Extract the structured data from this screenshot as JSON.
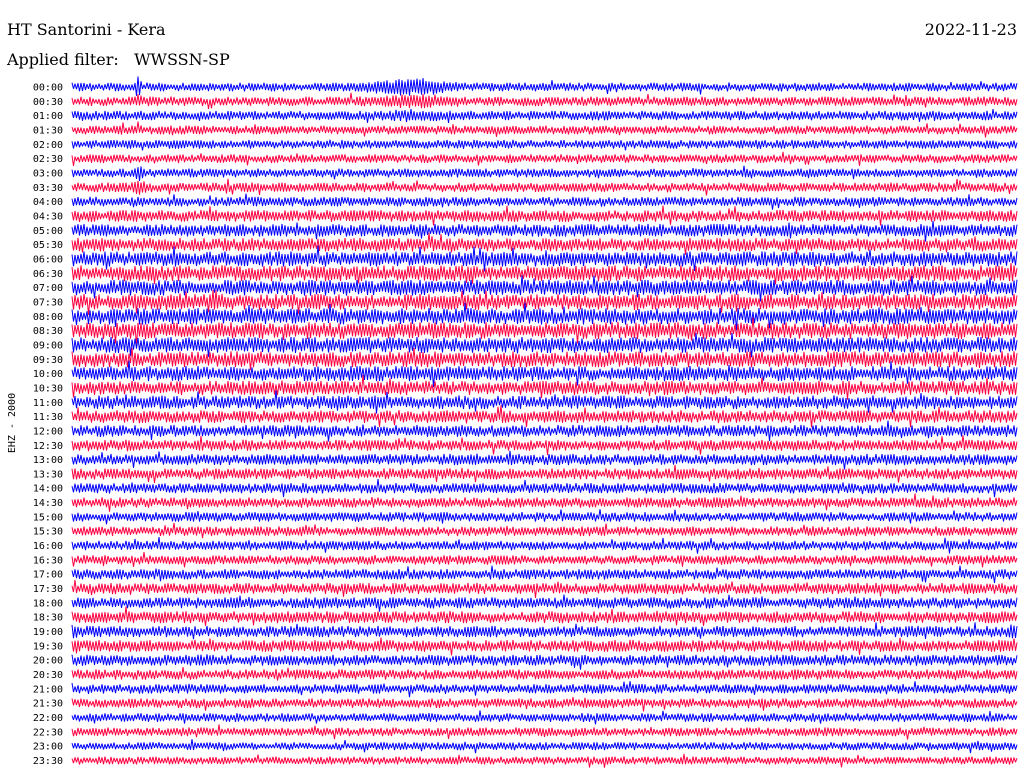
{
  "header": {
    "station": "HT Santorini - Kera",
    "date": "2022-11-23",
    "filter_label": "Applied filter:",
    "filter_value": "WWSSN-SP"
  },
  "chart_data": {
    "type": "line",
    "title": "HT Santorini - Kera",
    "subtitle": "Applied filter: WWSSN-SP",
    "ylabel": "EHZ - 2000",
    "date": "2022-11-23",
    "row_labels": [
      "00:00",
      "00:30",
      "01:00",
      "01:30",
      "02:00",
      "02:30",
      "03:00",
      "03:30",
      "04:00",
      "04:30",
      "05:00",
      "05:30",
      "06:00",
      "06:30",
      "07:00",
      "07:30",
      "08:00",
      "08:30",
      "09:00",
      "09:30",
      "10:00",
      "10:30",
      "11:00",
      "11:30",
      "12:00",
      "12:30",
      "13:00",
      "13:30",
      "14:00",
      "14:30",
      "15:00",
      "15:30",
      "16:00",
      "16:30",
      "17:00",
      "17:30",
      "18:00",
      "18:30",
      "19:00",
      "19:30",
      "20:00",
      "20:30",
      "21:00",
      "21:30",
      "22:00",
      "22:30",
      "23:00",
      "23:30"
    ],
    "trace_colors": [
      "#0000ff",
      "#ff0040"
    ],
    "grid": false,
    "relative_amplitude": [
      0.55,
      0.6,
      0.6,
      0.55,
      0.55,
      0.55,
      0.55,
      0.6,
      0.6,
      0.75,
      0.8,
      0.85,
      0.95,
      1.0,
      1.0,
      1.0,
      1.05,
      1.05,
      1.0,
      1.0,
      0.95,
      0.9,
      0.85,
      0.8,
      0.75,
      0.7,
      0.7,
      0.7,
      0.65,
      0.65,
      0.6,
      0.6,
      0.6,
      0.6,
      0.65,
      0.7,
      0.7,
      0.75,
      0.7,
      0.75,
      0.7,
      0.65,
      0.6,
      0.6,
      0.55,
      0.55,
      0.5,
      0.5
    ],
    "events": [
      {
        "row": 0,
        "position": 0.07,
        "amplitude": 5.5,
        "width": 0.004
      },
      {
        "row": 1,
        "position": 0.07,
        "amplitude": 2.5,
        "width": 0.004
      },
      {
        "row": 0,
        "position": 0.355,
        "amplitude": 3.2,
        "width": 0.06
      },
      {
        "row": 1,
        "position": 0.36,
        "amplitude": 2.2,
        "width": 0.06
      },
      {
        "row": 2,
        "position": 0.36,
        "amplitude": 1.6,
        "width": 0.05
      },
      {
        "row": 3,
        "position": 0.07,
        "amplitude": 1.8,
        "width": 0.004
      },
      {
        "row": 6,
        "position": 0.07,
        "amplitude": 2.6,
        "width": 0.01
      },
      {
        "row": 7,
        "position": 0.07,
        "amplitude": 2.2,
        "width": 0.01
      },
      {
        "row": 38,
        "position": 0.004,
        "amplitude": 2.0,
        "width": 0.006
      },
      {
        "row": 39,
        "position": 0.004,
        "amplitude": 1.8,
        "width": 0.006
      },
      {
        "row": 38,
        "position": 0.995,
        "amplitude": 2.2,
        "width": 0.006
      },
      {
        "row": 39,
        "position": 0.995,
        "amplitude": 1.8,
        "width": 0.006
      }
    ]
  }
}
